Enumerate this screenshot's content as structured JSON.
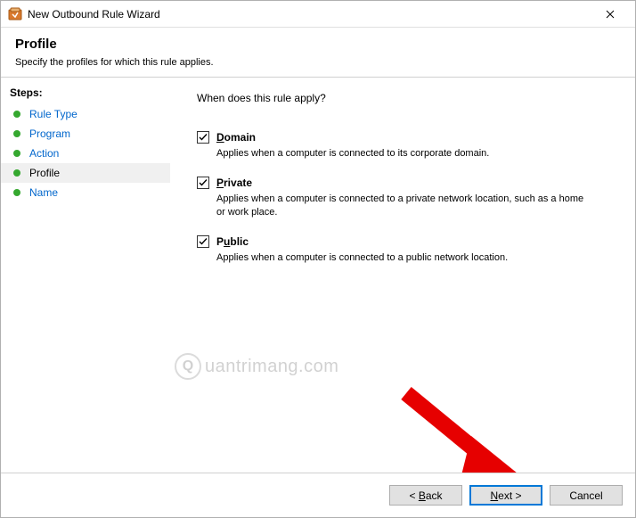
{
  "window": {
    "title": "New Outbound Rule Wizard"
  },
  "header": {
    "title": "Profile",
    "subtitle": "Specify the profiles for which this rule applies."
  },
  "sidebar": {
    "heading": "Steps:",
    "steps": [
      {
        "label": "Rule Type",
        "current": false
      },
      {
        "label": "Program",
        "current": false
      },
      {
        "label": "Action",
        "current": false
      },
      {
        "label": "Profile",
        "current": true
      },
      {
        "label": "Name",
        "current": false
      }
    ]
  },
  "content": {
    "question": "When does this rule apply?",
    "options": [
      {
        "key": "domain",
        "checked": true,
        "label_underline": "D",
        "label_rest": "omain",
        "desc": "Applies when a computer is connected to its corporate domain."
      },
      {
        "key": "private",
        "checked": true,
        "label_underline": "P",
        "label_rest": "rivate",
        "desc": "Applies when a computer is connected to a private network location, such as a home or work place."
      },
      {
        "key": "public",
        "checked": true,
        "label_underline": "u",
        "label_prefix": "P",
        "label_rest": "blic",
        "desc": "Applies when a computer is connected to a public network location."
      }
    ]
  },
  "footer": {
    "back_ul": "B",
    "back_pre": "< ",
    "back_post": "ack",
    "next_ul": "N",
    "next_post": "ext >",
    "cancel": "Cancel"
  },
  "watermark": {
    "glyph": "Q",
    "text": "uantrimang.com"
  }
}
